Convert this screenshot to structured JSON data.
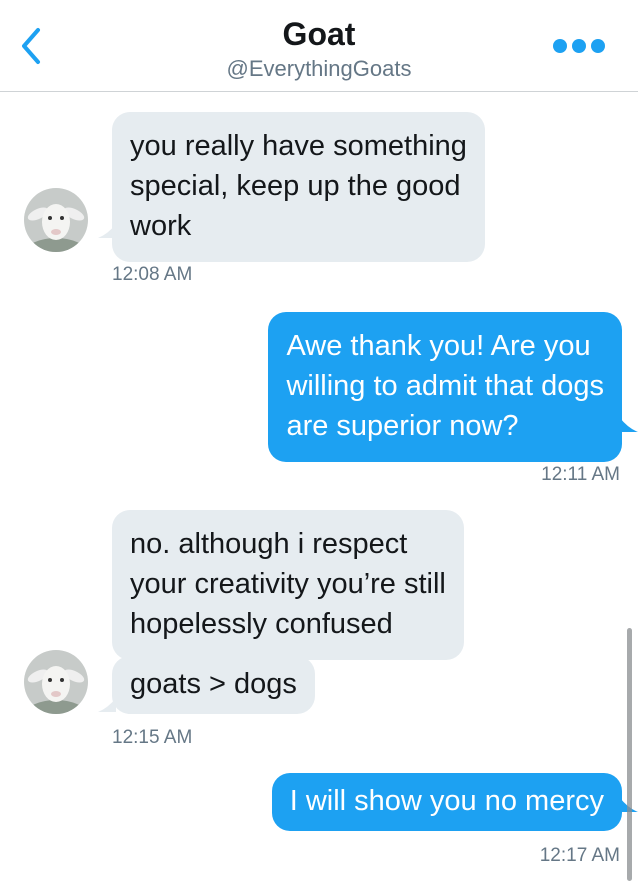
{
  "header": {
    "title": "Goat",
    "handle": "@EverythingGoats",
    "back_icon": "chevron-left-icon",
    "more_icon": "more-dots-icon"
  },
  "colors": {
    "accent": "#1da1f2",
    "incoming_bubble": "#e6ecf0",
    "timestamp": "#657786"
  },
  "messages": [
    {
      "from": "them",
      "lines": [
        "you really have something",
        "special, keep up the good",
        "work"
      ],
      "time": "12:08 AM"
    },
    {
      "from": "me",
      "lines": [
        "Awe thank you! Are you",
        "willing to admit that dogs",
        "are superior now?"
      ],
      "time": "12:11 AM"
    },
    {
      "from": "them",
      "lines": [
        "no. although i respect",
        "your creativity you’re still",
        "hopelessly confused"
      ]
    },
    {
      "from": "them",
      "lines": [
        "goats > dogs"
      ],
      "time": "12:15 AM"
    },
    {
      "from": "me",
      "lines": [
        "I will show you no mercy"
      ],
      "time": "12:17 AM"
    }
  ]
}
